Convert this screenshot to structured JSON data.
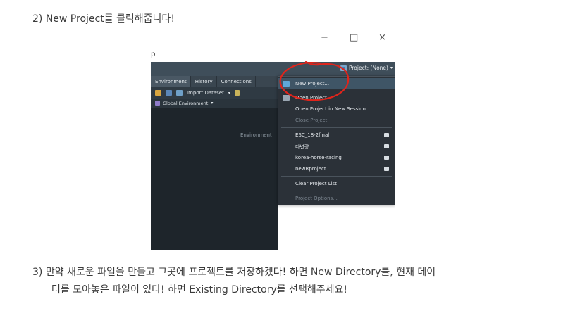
{
  "step2": {
    "text": "2)  New Project를 클릭해줍니다!"
  },
  "window_controls": {
    "minimize": "−",
    "maximize": "□",
    "close": "×"
  },
  "screenshot": {
    "partial_title": "p",
    "project_button": "Project: (None)",
    "tabs": [
      "Environment",
      "History",
      "Connections"
    ],
    "toolbar": {
      "import_label": "Import Dataset"
    },
    "env_selector": "Global Environment",
    "env_placeholder": "Environment",
    "menu": {
      "items": [
        {
          "label": "New Project...",
          "state": "highlight"
        },
        {
          "label": "Open Project..."
        },
        {
          "label": "Open Project in New Session..."
        },
        {
          "label": "Close Project",
          "state": "disabled"
        },
        {
          "label": "ESC_18-2final"
        },
        {
          "label": "다변량"
        },
        {
          "label": "korea-horse-racing"
        },
        {
          "label": "newRproject"
        },
        {
          "label": "Clear Project List"
        },
        {
          "label": "Project Options...",
          "state": "disabled"
        }
      ]
    }
  },
  "step3": {
    "line1": "3)  만약 새로운 파일을 만들고 그곳에 프로젝트를 저장하겠다! 하면 New Directory를, 현재 데이",
    "line2": "터를 모아놓은 파일이 있다! 하면 Existing Directory를 선택해주세요!"
  },
  "colors": {
    "accent_circle": "#e0241b",
    "menu_bg": "#2b3138",
    "panel_bg": "#1e252b"
  }
}
